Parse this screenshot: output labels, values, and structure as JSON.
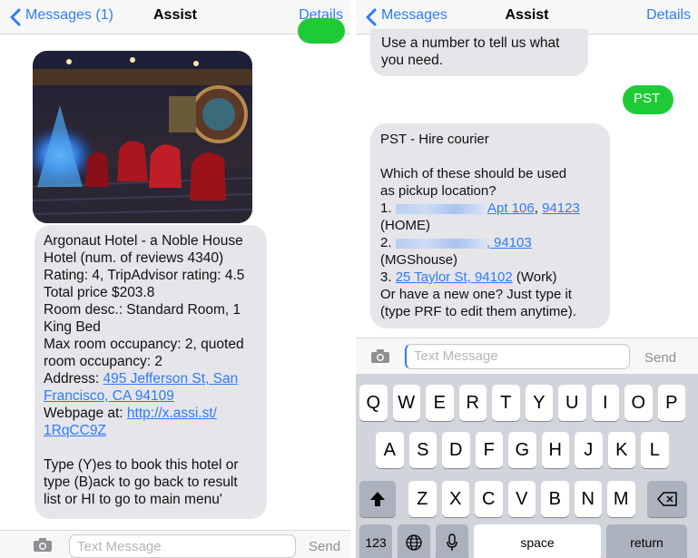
{
  "left": {
    "nav": {
      "back_label": "Messages (1)",
      "title": "Assist",
      "details_label": "Details"
    },
    "hotel_message": {
      "lines": [
        "Argonaut Hotel - a Noble House",
        "Hotel (num. of reviews 4340)",
        "Rating: 4, TripAdvisor rating: 4.5",
        "Total price $203.8",
        "Room desc.: Standard Room, 1",
        "King Bed",
        "Max room occupancy: 2, quoted",
        "room occupancy: 2"
      ],
      "address_label": "Address: ",
      "address_link_1": "495 Jefferson St, San",
      "address_link_2": "Francisco, CA 94109",
      "webpage_label": "Webpage at: ",
      "webpage_link_1": "http://x.assi.st/",
      "webpage_link_2": "1RqCC9Z",
      "instructions": "Type (Y)es to book this hotel or\ntype (B)ack to go back to result\nlist or HI to go to main menu'"
    },
    "input": {
      "placeholder": "Text Message",
      "send_label": "Send"
    }
  },
  "right": {
    "nav": {
      "back_label": "Messages",
      "title": "Assist",
      "details_label": "Details"
    },
    "prev_message": "Use a number to tell us what\nyou need.",
    "sent_message": "PST",
    "pickup_message": {
      "intro": "PST - Hire courier\n\nWhich of these should be used\nas pickup location?",
      "opt1_prefix": "1. ",
      "opt1_link": "Apt 106",
      "opt1_sep": ", ",
      "opt1_zip": "94123",
      "opt1_tag": "(HOME)",
      "opt2_prefix": "2. ",
      "opt2_zip": ", 94103",
      "opt2_tag": "(MGShouse)",
      "opt3_prefix": "3. ",
      "opt3_link": "25 Taylor St, 94102",
      "opt3_tag": " (Work)",
      "outro": "Or have a new one? Just type it\n(type PRF to edit them anytime)."
    },
    "input": {
      "placeholder": "Text Message",
      "send_label": "Send"
    },
    "keyboard": {
      "row1": [
        "Q",
        "W",
        "E",
        "R",
        "T",
        "Y",
        "U",
        "I",
        "O",
        "P"
      ],
      "row2": [
        "A",
        "S",
        "D",
        "F",
        "G",
        "H",
        "J",
        "K",
        "L"
      ],
      "row3": [
        "Z",
        "X",
        "C",
        "V",
        "B",
        "N",
        "M"
      ],
      "numbers_label": "123",
      "space_label": "space",
      "return_label": "return"
    }
  },
  "colors": {
    "accent": "#2f7cf6",
    "sent_bubble": "#1ecb36",
    "received_bubble": "#e5e5ea"
  }
}
